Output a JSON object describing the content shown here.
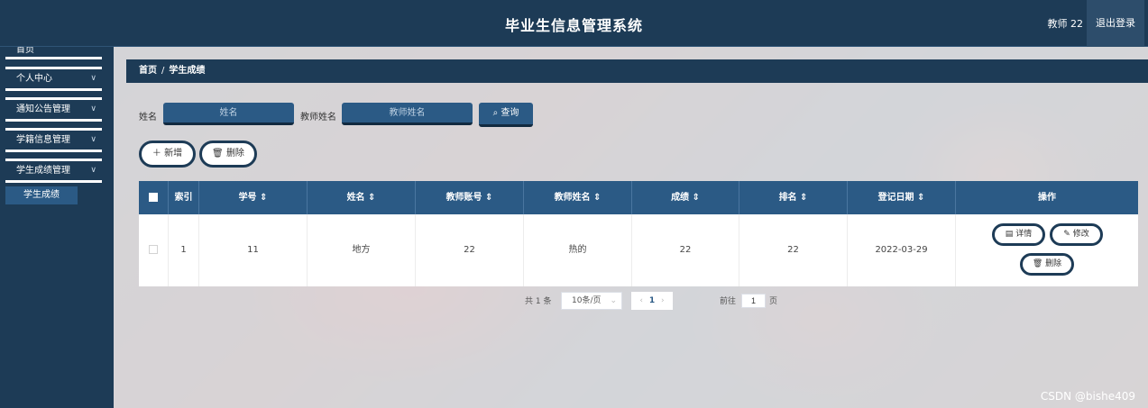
{
  "header": {
    "title": "毕业生信息管理系统",
    "user": "教师 22",
    "logout": "退出登录"
  },
  "sidebar": {
    "top": "首页",
    "items": [
      {
        "label": "个人中心"
      },
      {
        "label": "通知公告管理"
      },
      {
        "label": "学籍信息管理"
      },
      {
        "label": "学生成绩管理"
      }
    ],
    "sub_active": "学生成绩"
  },
  "breadcrumb": {
    "home": "首页",
    "sep": "/",
    "current": "学生成绩"
  },
  "search": {
    "name_label": "姓名",
    "name_placeholder": "姓名",
    "teacher_label": "教师姓名",
    "teacher_placeholder": "教师姓名",
    "query": "查询"
  },
  "actions": {
    "add": "新增",
    "delete": "删除"
  },
  "table": {
    "columns": [
      "索引",
      "学号 ⇕",
      "姓名 ⇕",
      "教师账号 ⇕",
      "教师姓名 ⇕",
      "成绩 ⇕",
      "排名 ⇕",
      "登记日期 ⇕",
      "操作"
    ],
    "rows": [
      {
        "index": "1",
        "student_id": "11",
        "name": "地方",
        "teacher_account": "22",
        "teacher_name": "热的",
        "score": "22",
        "rank": "22",
        "date": "2022-03-29"
      }
    ],
    "ops": {
      "detail": "详情",
      "edit": "修改",
      "delete": "删除"
    }
  },
  "pagination": {
    "total": "共 1 条",
    "page_size": "10条/页",
    "prev": "‹",
    "current": "1",
    "next": "›",
    "goto": "前往",
    "jump": "1",
    "page_word": "页"
  },
  "watermark": "CSDN @bishe409"
}
